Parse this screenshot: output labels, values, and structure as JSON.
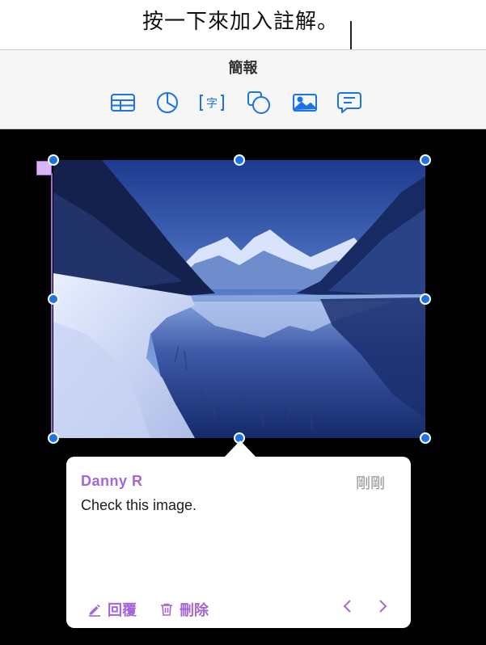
{
  "callout": {
    "text": "按一下來加入註解。"
  },
  "toolbar": {
    "title": "簡報",
    "icons": [
      "table-icon",
      "chart-icon",
      "text-icon",
      "shape-icon",
      "media-icon",
      "comment-icon"
    ],
    "text_icon_glyph": "字"
  },
  "comment": {
    "author": "Danny R",
    "time": "剛剛",
    "message": "Check this image.",
    "reply_label": "回覆",
    "delete_label": "刪除"
  },
  "colors": {
    "accent_blue": "#1a73e8",
    "comment_purple": "#a466d8",
    "canvas_bg": "#000000"
  }
}
